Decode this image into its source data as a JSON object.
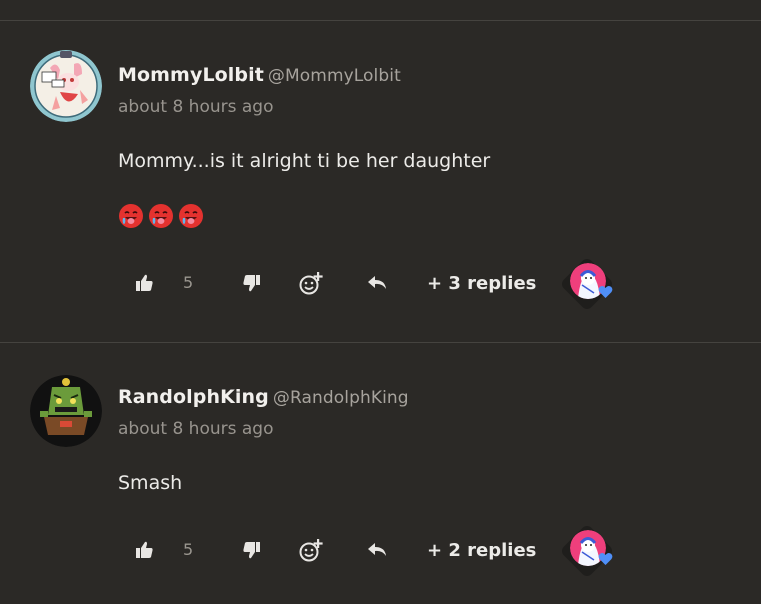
{
  "comments": [
    {
      "username": "MommyLolbit",
      "handle": "@MommyLolbit",
      "timestamp": "about 8 hours ago",
      "text": "Mommy...is it alright ti be her daughter",
      "emoji_icons": [
        "drooling-face-icon",
        "drooling-face-icon",
        "drooling-face-icon"
      ],
      "likes": "5",
      "replies_label": "+ 3 replies"
    },
    {
      "username": "RandolphKing",
      "handle": "@RandolphKing",
      "timestamp": "about 8 hours ago",
      "text": "Smash",
      "likes": "5",
      "replies_label": "+ 2 replies"
    }
  ],
  "colors": {
    "background": "#2b2926",
    "divider": "#45433f",
    "heart": "#4f8ff7"
  }
}
